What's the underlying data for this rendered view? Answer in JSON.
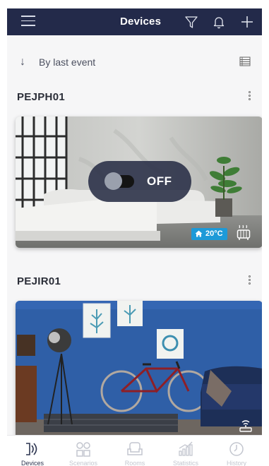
{
  "header": {
    "title": "Devices",
    "icons": [
      "menu-icon",
      "filter-icon",
      "bell-icon",
      "plus-icon"
    ]
  },
  "sort": {
    "label": "By last event",
    "arrow": "↓"
  },
  "devices": [
    {
      "name": "PEJPH01",
      "state": "OFF",
      "temperature": "20°C",
      "status_icon": "heater-icon"
    },
    {
      "name": "PEJIR01",
      "status_icon": "router-icon"
    }
  ],
  "tabs": [
    {
      "label": "Devices",
      "icon": "devices-icon",
      "active": true
    },
    {
      "label": "Scenarios",
      "icon": "scenarios-icon",
      "active": false
    },
    {
      "label": "Rooms",
      "icon": "rooms-icon",
      "active": false
    },
    {
      "label": "Statistics",
      "icon": "statistics-icon",
      "active": false
    },
    {
      "label": "History",
      "icon": "history-icon",
      "active": false
    }
  ],
  "colors": {
    "header_bg": "#232a4a",
    "accent": "#1d9ad8",
    "tab_active": "#2d3550",
    "tab_inactive": "#c3c6cf"
  }
}
